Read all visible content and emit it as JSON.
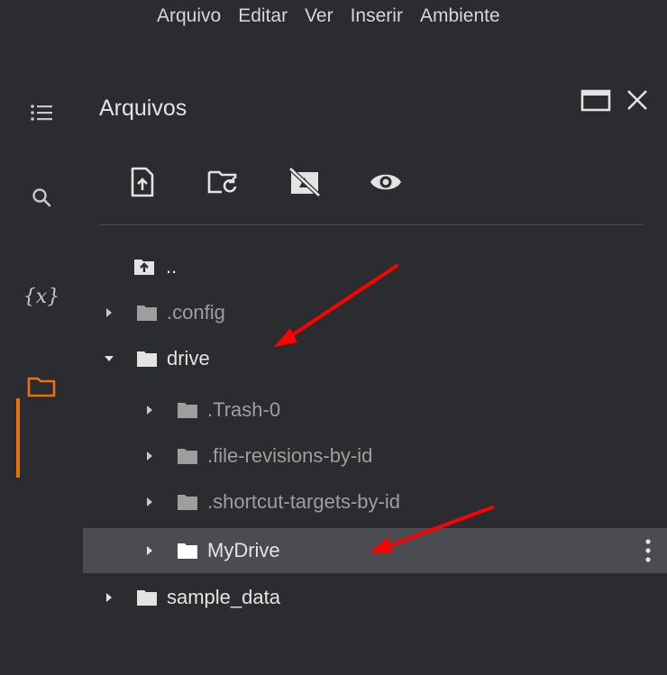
{
  "menu": {
    "items": [
      "Arquivo",
      "Editar",
      "Ver",
      "Inserir",
      "Ambiente"
    ]
  },
  "rail": {
    "items": [
      {
        "name": "toc-icon"
      },
      {
        "name": "search-icon"
      },
      {
        "name": "variables-icon",
        "label": "{x}"
      },
      {
        "name": "files-icon",
        "active": true
      }
    ]
  },
  "panel": {
    "title": "Arquivos"
  },
  "tree": {
    "rows": [
      {
        "label": "..",
        "type": "parent"
      },
      {
        "label": ".config",
        "type": "folder",
        "state": "collapsed",
        "level": 0,
        "dim": true
      },
      {
        "label": "drive",
        "type": "folder",
        "state": "expanded",
        "level": 0
      },
      {
        "label": ".Trash-0",
        "type": "folder",
        "state": "collapsed",
        "level": 1,
        "dim": true
      },
      {
        "label": ".file-revisions-by-id",
        "type": "folder",
        "state": "collapsed",
        "level": 1,
        "dim": true
      },
      {
        "label": ".shortcut-targets-by-id",
        "type": "folder",
        "state": "collapsed",
        "level": 1,
        "dim": true
      },
      {
        "label": "MyDrive",
        "type": "folder",
        "state": "collapsed",
        "level": 1,
        "selected": true
      },
      {
        "label": "sample_data",
        "type": "folder",
        "state": "collapsed",
        "level": 0
      }
    ]
  },
  "colors": {
    "background": "#2b2c2f",
    "accent": "#e8710a",
    "selected_row": "#4b4c50",
    "annotation_arrow": "#ff0000"
  }
}
